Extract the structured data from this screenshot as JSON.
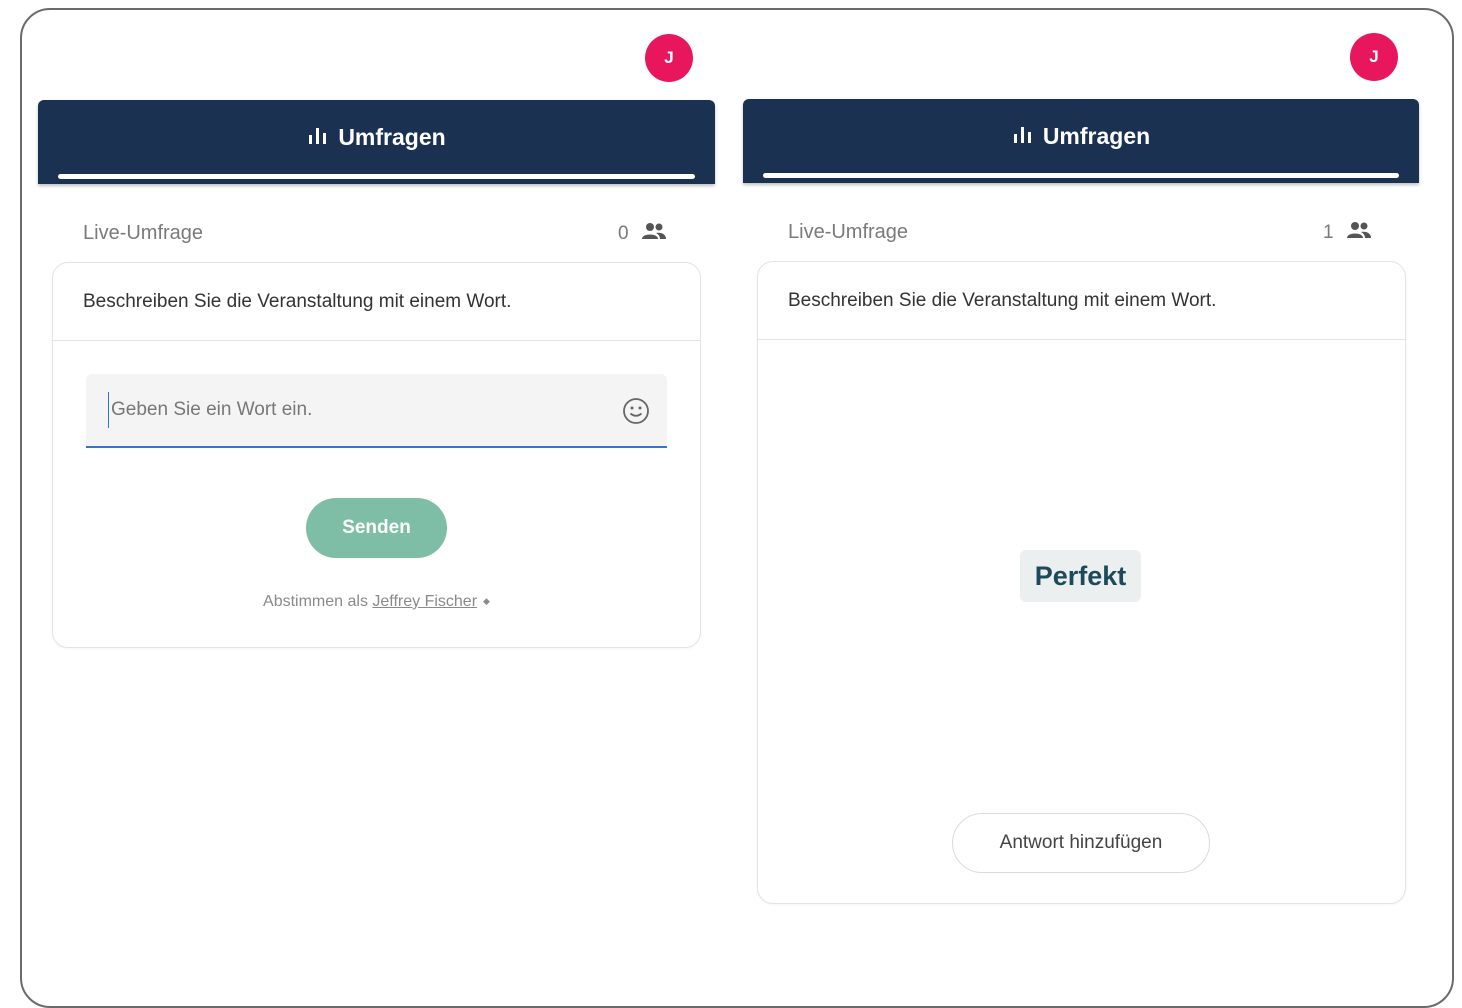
{
  "panels": [
    {
      "avatar_letter": "J",
      "header_title": "Umfragen",
      "live_label": "Live-Umfrage",
      "participant_count": "0",
      "question": "Beschreiben Sie die Veranstaltung mit einem Wort.",
      "input_placeholder": "Geben Sie ein Wort ein.",
      "send_label": "Senden",
      "vote_as_prefix": "Abstimmen als",
      "vote_as_name": "Jeffrey Fischer"
    },
    {
      "avatar_letter": "J",
      "header_title": "Umfragen",
      "live_label": "Live-Umfrage",
      "participant_count": "1",
      "question": "Beschreiben Sie die Veranstaltung mit einem Wort.",
      "word_result": "Perfekt",
      "add_answer_label": "Antwort hinzufügen"
    }
  ],
  "colors": {
    "header_bg": "#1b3152",
    "avatar_bg": "#e8175d",
    "send_button_bg": "#7ebda6",
    "input_focus": "#2f76d2",
    "word_text": "#1c4a5a"
  },
  "icons": [
    "bar-chart-icon",
    "people-icon",
    "emoji-icon",
    "diamond-icon"
  ]
}
